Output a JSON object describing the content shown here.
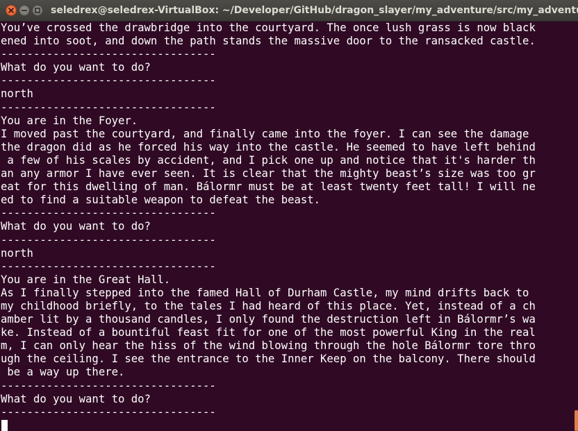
{
  "window": {
    "title": "seledrex@seledrex-VirtualBox: ~/Developer/GitHub/dragon_slayer/my_adventure/src/my_adventure",
    "controls": [
      "close-icon",
      "minimize-icon",
      "maximize-icon"
    ]
  },
  "colors": {
    "terminal_background": "#300a24",
    "text": "#ffffff",
    "close_button": "#e05a27",
    "scroll_thumb": "#e27d4c"
  },
  "terminal": {
    "lines": [
      "You’ve crossed the drawbridge into the courtyard. The once lush grass is now black",
      "ened into soot, and down the path stands the massive door to the ransacked castle.",
      "---------------------------------",
      "What do you want to do?",
      "---------------------------------",
      "north",
      "---------------------------------",
      "You are in the Foyer.",
      "I moved past the courtyard, and finally came into the foyer. I can see the damage",
      "the dragon did as he forced his way into the castle. He seemed to have left behind",
      " a few of his scales by accident, and I pick one up and notice that it's harder th",
      "an any armor I have ever seen. It is clear that the mighty beast’s size was too gr",
      "eat for this dwelling of man. Bálormr must be at least twenty feet tall! I will ne",
      "ed to find a suitable weapon to defeat the beast.",
      "---------------------------------",
      "What do you want to do?",
      "---------------------------------",
      "north",
      "---------------------------------",
      "You are in the Great Hall.",
      "As I finally stepped into the famed Hall of Durham Castle, my mind drifts back to",
      "my childhood briefly, to the tales I had heard of this place. Yet, instead of a ch",
      "amber lit by a thousand candles, I only found the destruction left in Bálormr’s wa",
      "ke. Instead of a bountiful feast fit for one of the most powerful King in the real",
      "m, I can only hear the hiss of the wind blowing through the hole Bálormr tore thro",
      "ugh the ceiling. I see the entrance to the Inner Keep on the balcony. There should",
      " be a way up there.",
      "---------------------------------",
      "What do you want to do?",
      "---------------------------------"
    ]
  }
}
